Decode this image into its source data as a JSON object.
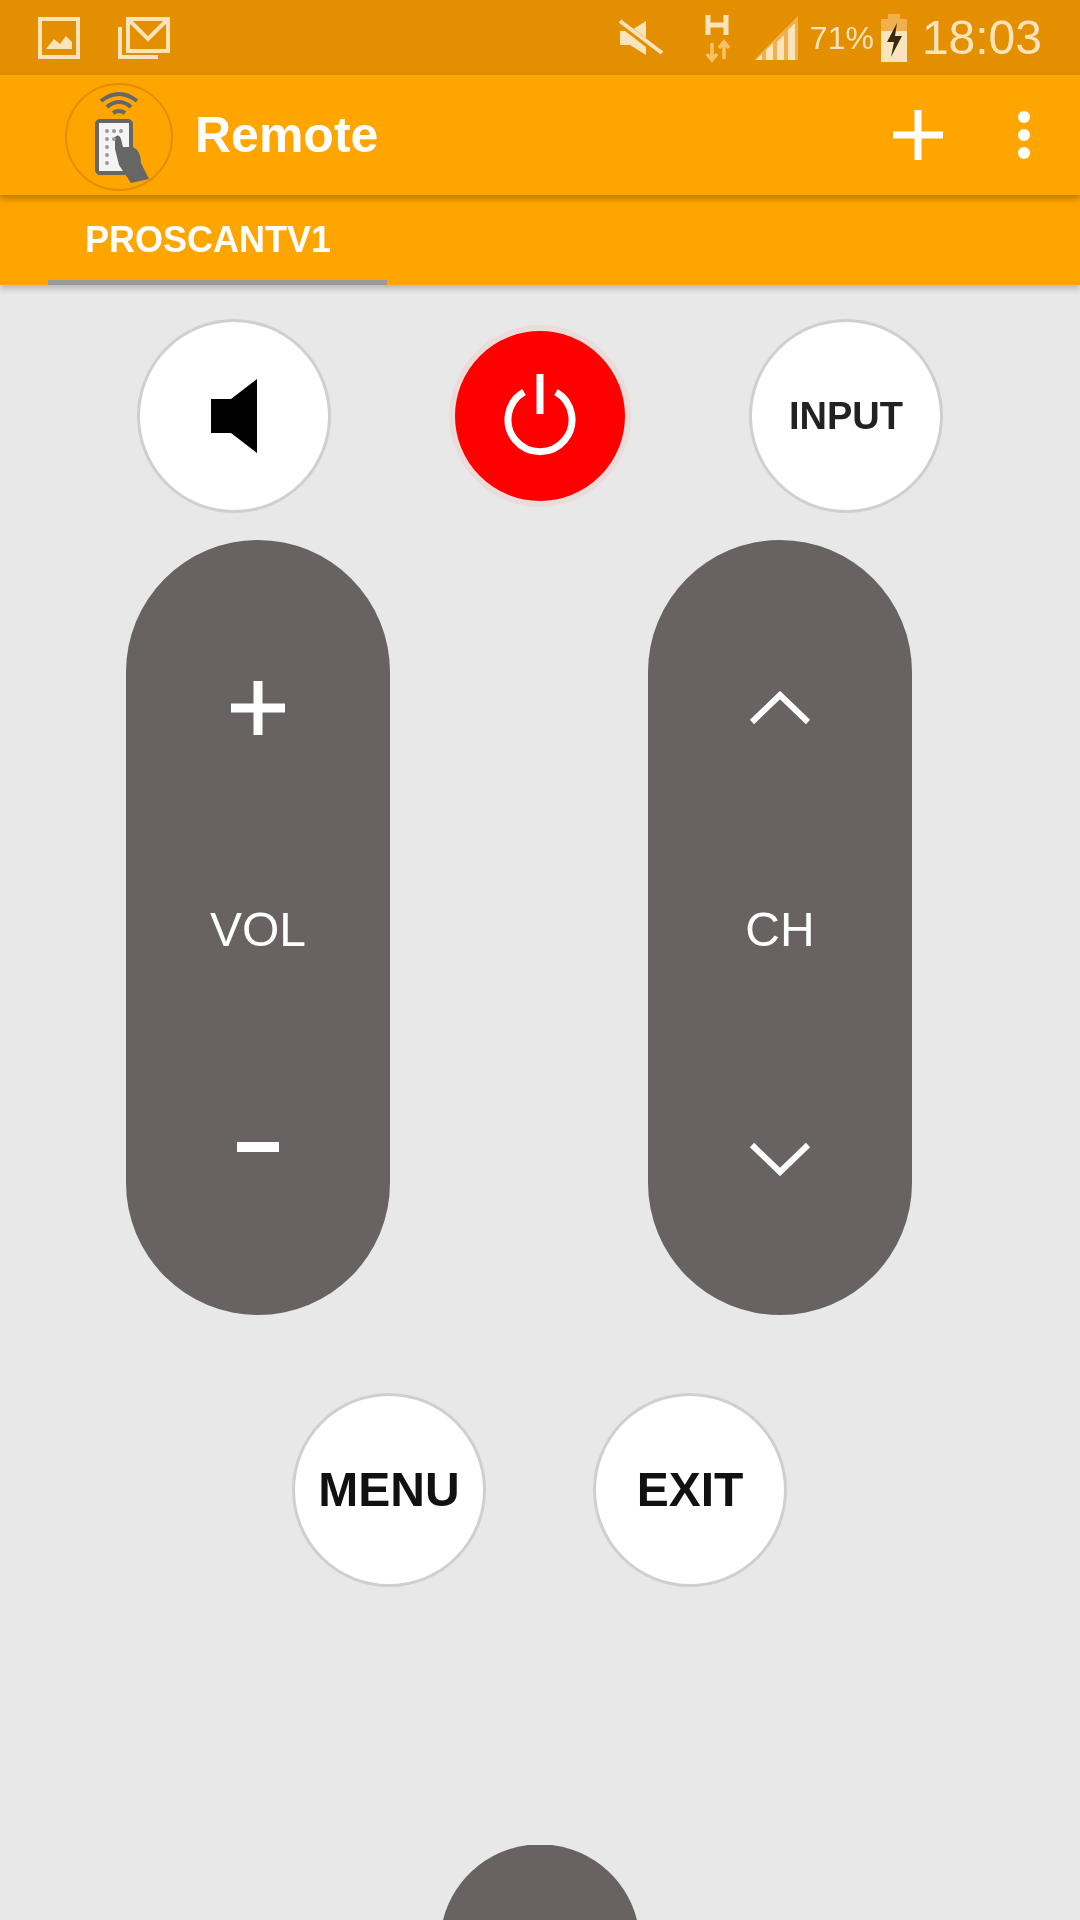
{
  "status_bar": {
    "battery": "71%",
    "time": "18:03"
  },
  "app_bar": {
    "title": "Remote"
  },
  "tabs": [
    {
      "label": "PROSCANTV1",
      "selected": true
    }
  ],
  "top_buttons": [
    {
      "kind": "mute"
    },
    {
      "kind": "power"
    },
    {
      "kind": "text",
      "label": "INPUT"
    }
  ],
  "rockers": [
    {
      "kind": "volume",
      "label": "VOL"
    },
    {
      "kind": "channel",
      "label": "CH"
    }
  ],
  "bottom_buttons": [
    {
      "label": "MENU"
    },
    {
      "label": "EXIT"
    }
  ]
}
